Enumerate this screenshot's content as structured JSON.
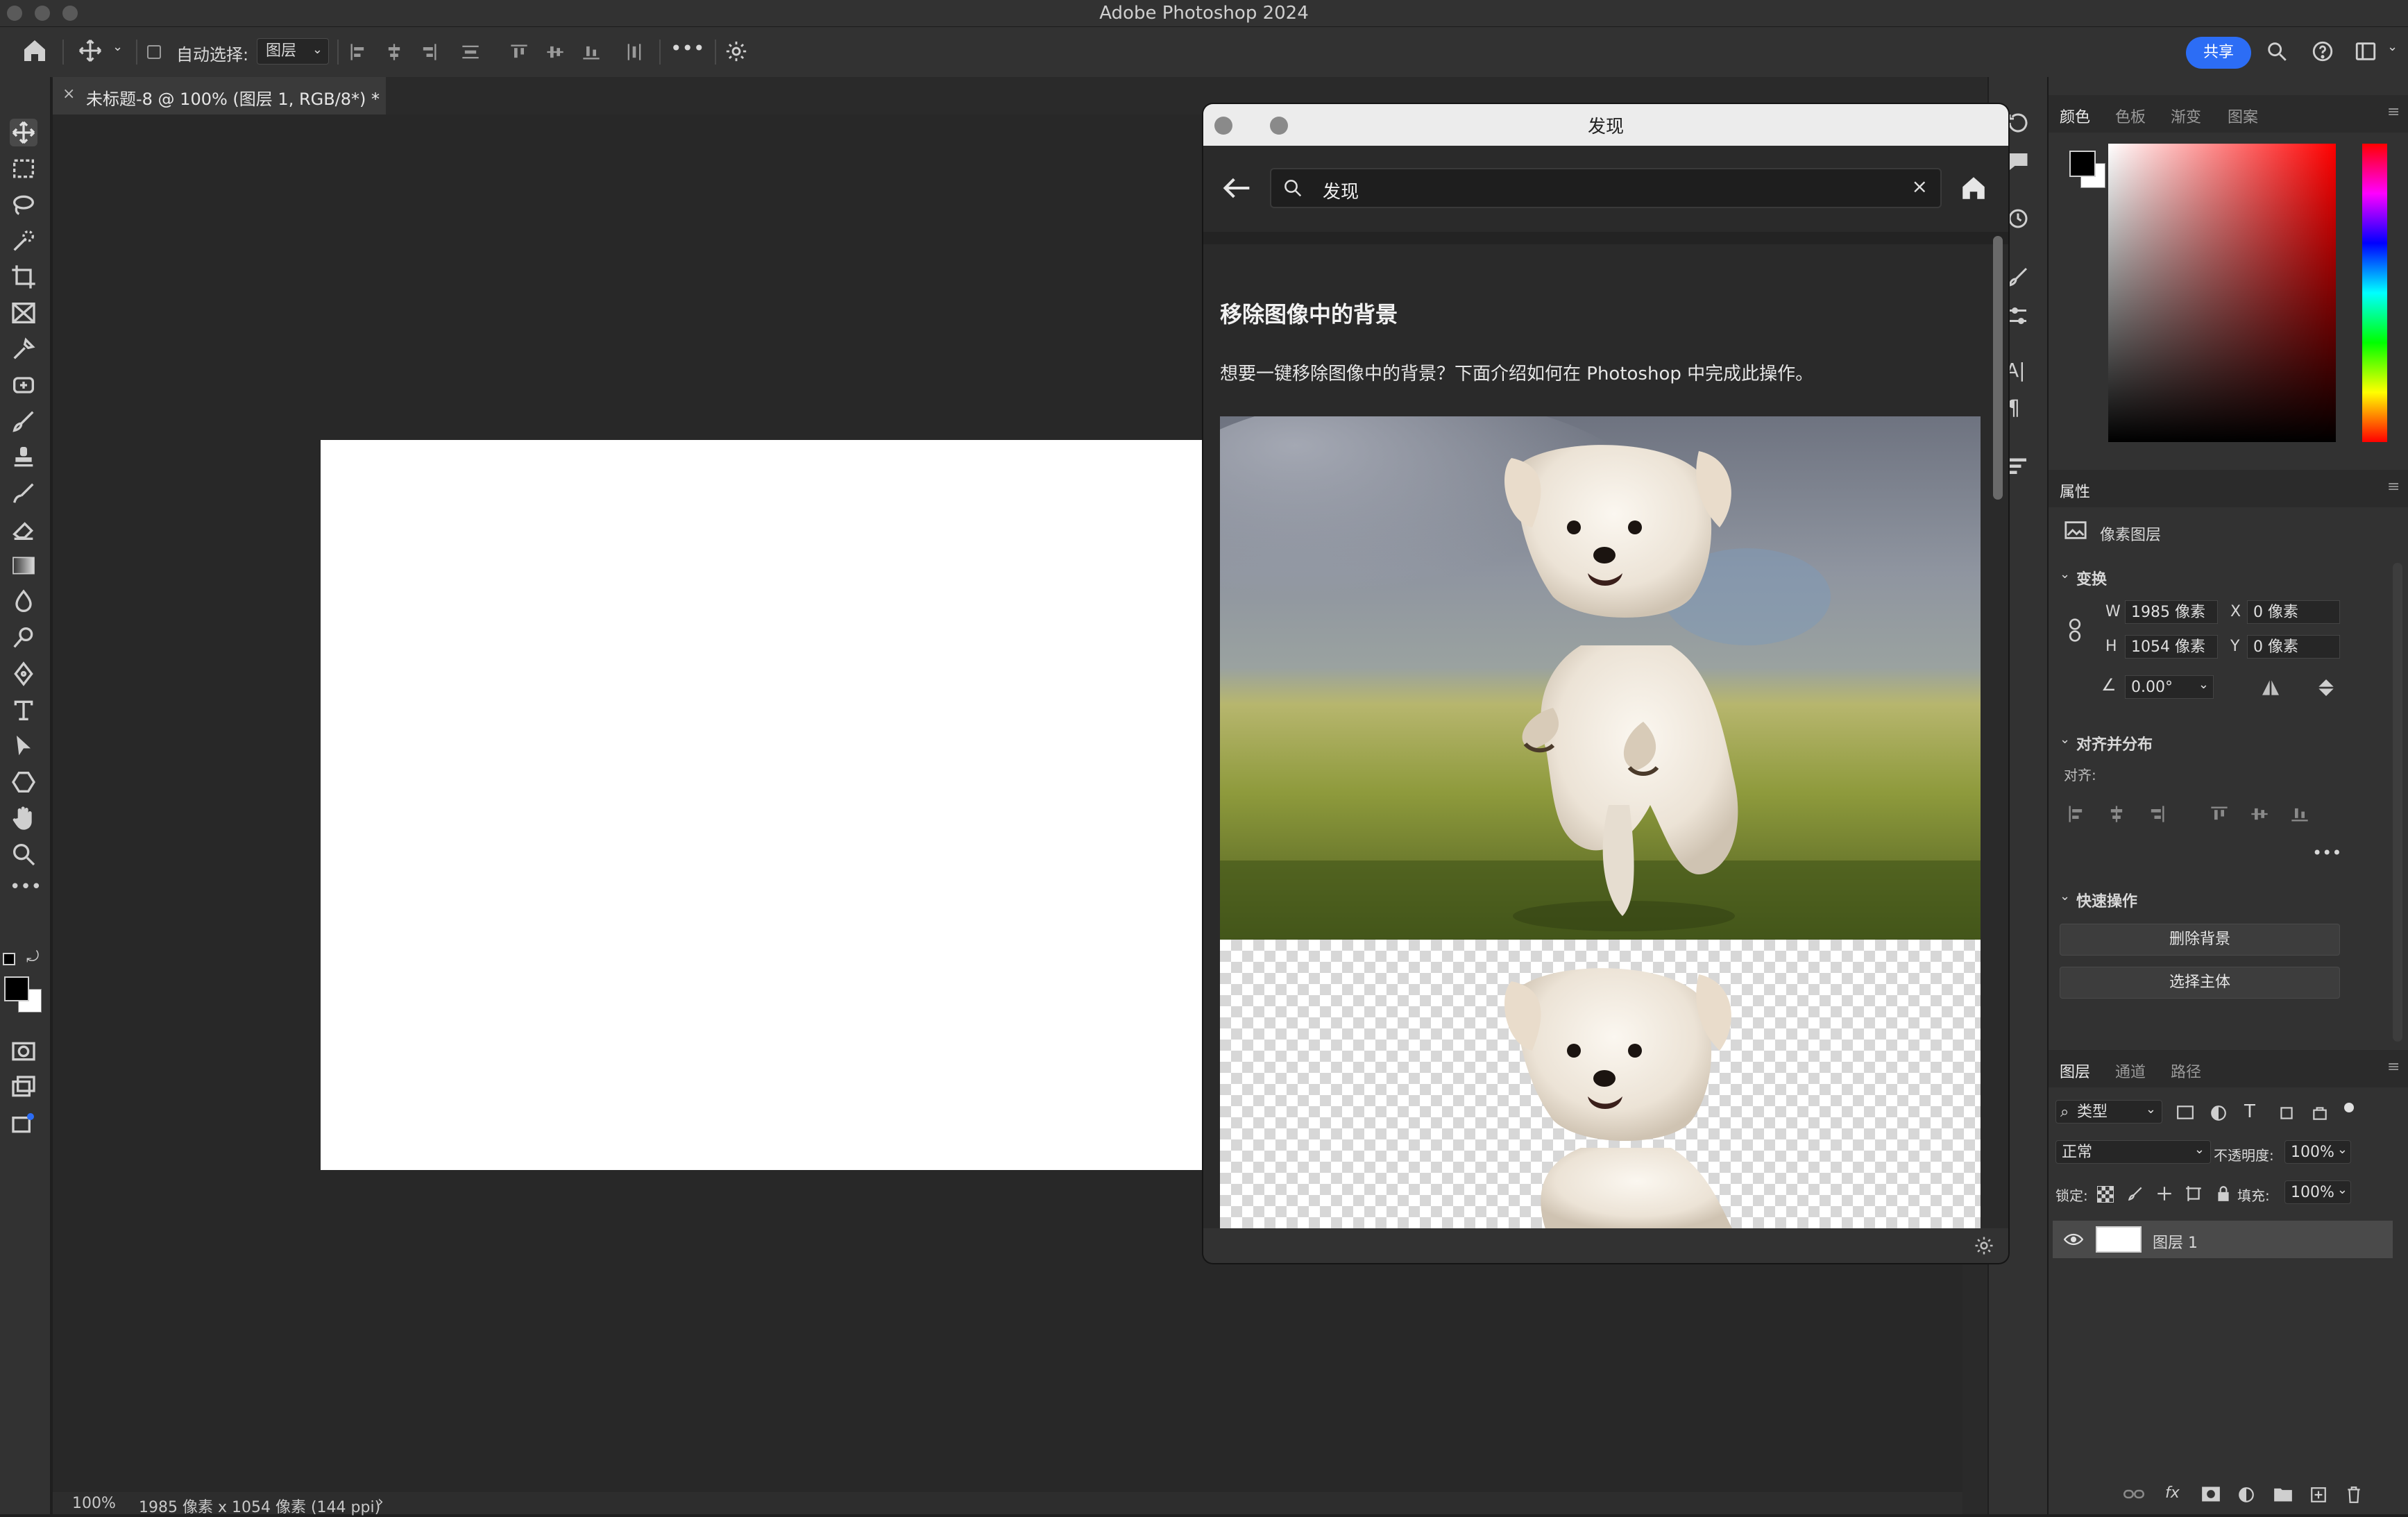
{
  "titlebar": {
    "title": "Adobe Photoshop 2024"
  },
  "options": {
    "auto_select_label": "自动选择:",
    "auto_select_value": "图层",
    "share_label": "共享",
    "more": "•••"
  },
  "doc": {
    "tab_title": "未标题-8 @ 100% (图层 1, RGB/8*) *",
    "tab_close": "×"
  },
  "status": {
    "zoom": "100%",
    "info": "1985 像素 x 1054 像素 (144 ppi)",
    "arrow": "›"
  },
  "discover": {
    "window_title": "发现",
    "search_value": "发现",
    "clear": "×",
    "article_title": "移除图像中的背景",
    "article_desc": "想要一键移除图像中的背景？下面介绍如何在 Photoshop 中完成此操作。",
    "photo_original": "running white fluffy dog on grass",
    "photo_cutout": "same dog with background removed on transparency grid"
  },
  "color_panel": {
    "tabs": [
      "颜色",
      "色板",
      "渐变",
      "图案"
    ]
  },
  "properties": {
    "title": "属性",
    "layer_type": "像素图层",
    "transform_label": "变换",
    "w_label": "W",
    "w_value": "1985 像素",
    "x_label": "X",
    "x_value": "0 像素",
    "h_label": "H",
    "h_value": "1054 像素",
    "y_label": "Y",
    "y_value": "0 像素",
    "angle_value": "0.00°",
    "align_section": "对齐并分布",
    "align_label": "对齐:",
    "more": "•••",
    "quick_actions": "快速操作",
    "remove_bg_btn": "删除背景",
    "select_subject_btn": "选择主体"
  },
  "layers": {
    "tabs": [
      "图层",
      "通道",
      "路径"
    ],
    "filter_label": "类型",
    "blend_mode": "正常",
    "opacity_label": "不透明度:",
    "opacity_value": "100%",
    "lock_label": "锁定:",
    "fill_label": "填充:",
    "fill_value": "100%",
    "layer_name": "图层 1",
    "fx": "fx"
  },
  "colors": {
    "accent": "#2c6df5",
    "fg": "#000000",
    "bg": "#ffffff"
  }
}
